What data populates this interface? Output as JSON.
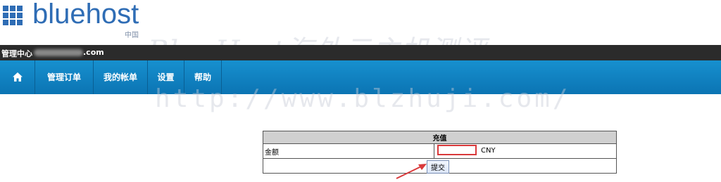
{
  "brand": {
    "logo_text": "bluehost",
    "region": "中国"
  },
  "account_bar": {
    "title": "管理中心",
    "domain_suffix": ".com"
  },
  "nav": {
    "home_icon": "home-icon",
    "items": [
      {
        "label": "管理订单"
      },
      {
        "label": "我的帐单"
      },
      {
        "label": "设置"
      },
      {
        "label": "帮助"
      }
    ]
  },
  "watermark": {
    "line1": "BlueHost海外云主机测评",
    "line2": "http://www.blzhuji.com/"
  },
  "recharge": {
    "header": "充值",
    "amount_label": "金额",
    "amount_value": "",
    "currency": "CNY",
    "submit_label": "提交"
  },
  "colors": {
    "brand_blue": "#2f6db5",
    "nav_blue": "#1283c4",
    "highlight_red": "#d9393b"
  }
}
